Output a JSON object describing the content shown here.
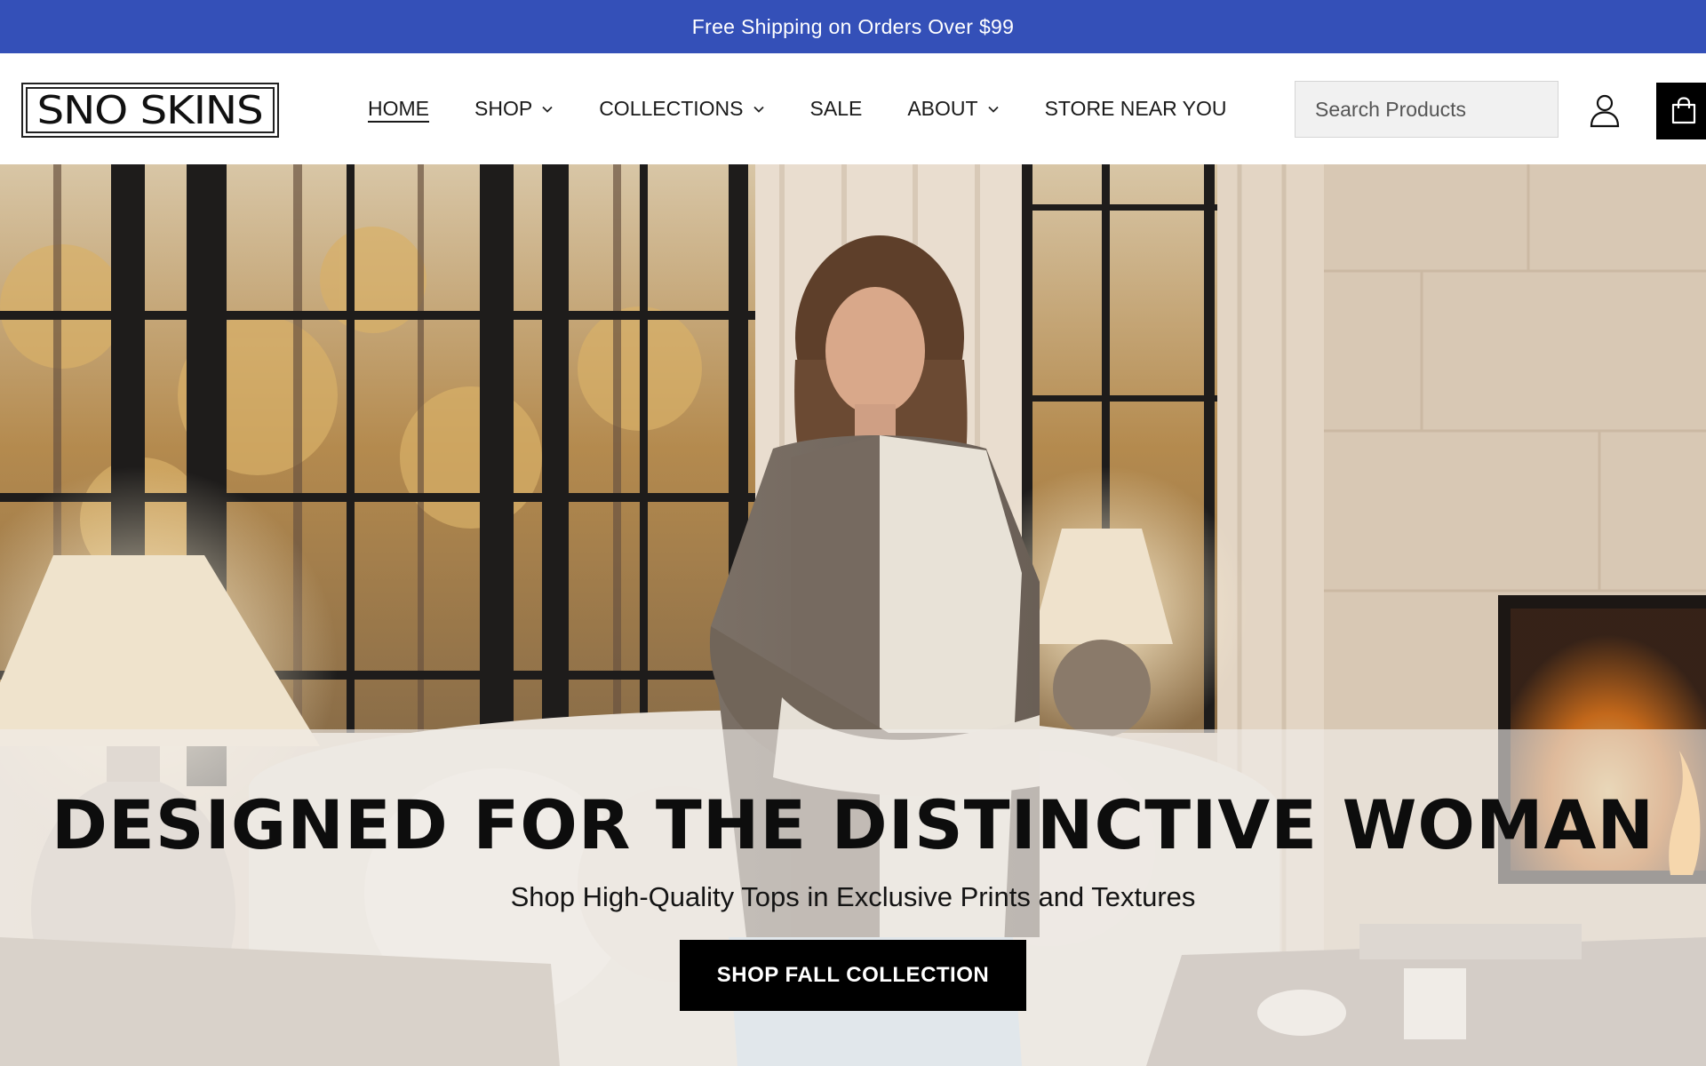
{
  "announcement": {
    "text": "Free Shipping on Orders Over $99"
  },
  "brand": {
    "logo_text": "SNO SKINS"
  },
  "nav": {
    "items": [
      {
        "label": "HOME",
        "active": true,
        "dropdown": false
      },
      {
        "label": "SHOP",
        "active": false,
        "dropdown": true
      },
      {
        "label": "COLLECTIONS",
        "active": false,
        "dropdown": true
      },
      {
        "label": "SALE",
        "active": false,
        "dropdown": false
      },
      {
        "label": "ABOUT",
        "active": false,
        "dropdown": true
      },
      {
        "label": "STORE NEAR YOU",
        "active": false,
        "dropdown": false
      }
    ]
  },
  "search": {
    "placeholder": "Search Products",
    "value": ""
  },
  "icons": {
    "search": "search-icon",
    "account": "account-icon",
    "cart": "cart-icon",
    "chevron": "chevron-down-icon"
  },
  "hero": {
    "title": "DESIGNED FOR THE DISTINCTIVE WOMAN",
    "subtitle": "Shop High-Quality Tops in Exclusive Prints and Textures",
    "cta": "SHOP FALL COLLECTION"
  },
  "colors": {
    "announcement_bg": "#3450b8",
    "cta_bg": "#000000",
    "cart_bg": "#000000"
  }
}
